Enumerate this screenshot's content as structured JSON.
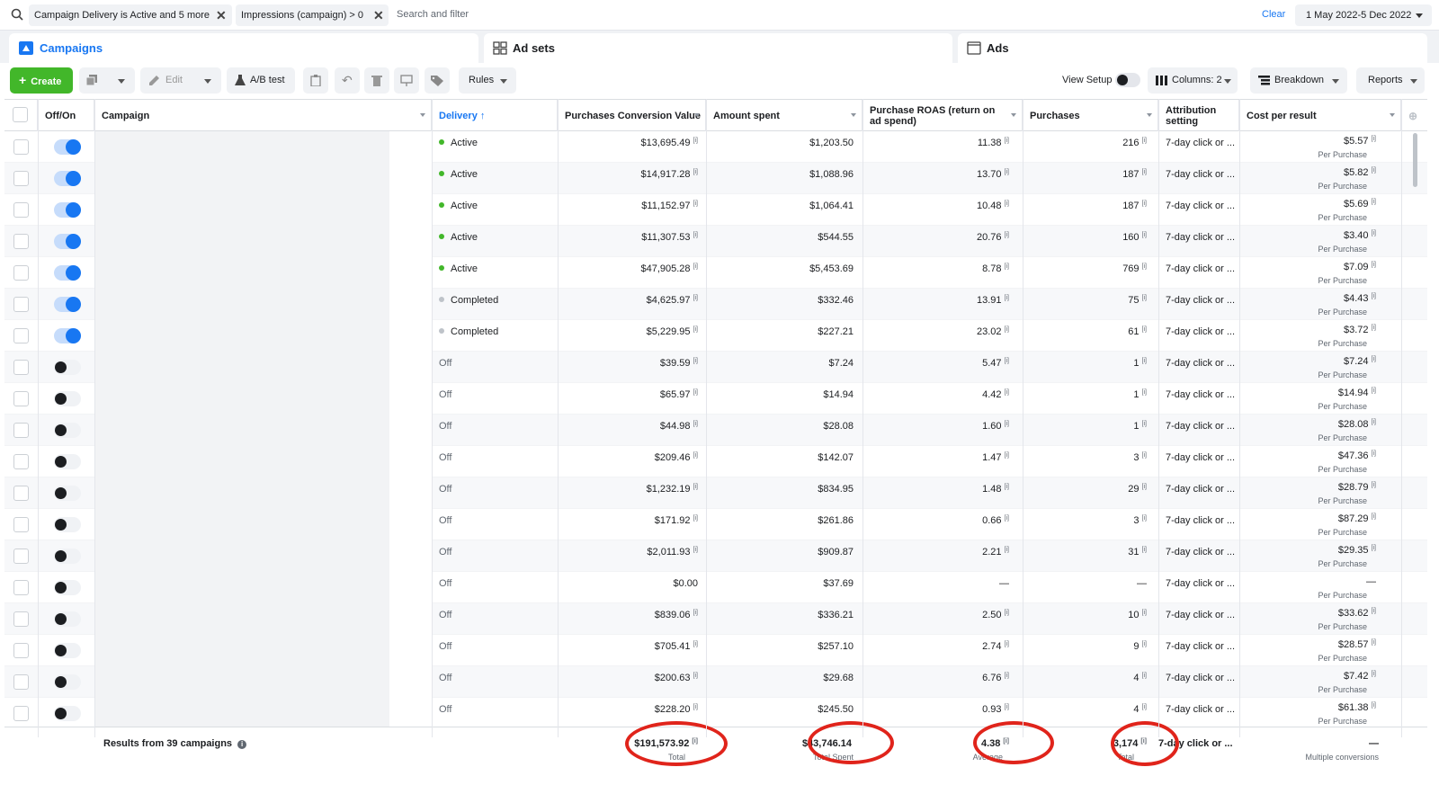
{
  "filters": {
    "chip1": "Campaign Delivery is Active and 5 more",
    "chip2": "Impressions (campaign) > 0",
    "search_placeholder": "Search and filter",
    "clear": "Clear",
    "date_range": "1 May 2022-5 Dec 2022"
  },
  "tabs": [
    {
      "label": "Campaigns",
      "icon": "campaign-icon"
    },
    {
      "label": "Ad sets",
      "icon": "grid-icon"
    },
    {
      "label": "Ads",
      "icon": "ad-icon"
    }
  ],
  "toolbar": {
    "create": "Create",
    "edit": "Edit",
    "ab_test": "A/B test",
    "rules": "Rules",
    "view_setup": "View Setup",
    "columns": "Columns: 2",
    "breakdown": "Breakdown",
    "reports": "Reports"
  },
  "columns": {
    "offon": "Off/On",
    "campaign": "Campaign",
    "delivery": "Delivery ↑",
    "pcv": "Purchases Conversion Value",
    "spent": "Amount spent",
    "roas": "Purchase ROAS (return on ad spend)",
    "purchases": "Purchases",
    "attribution": "Attribution setting",
    "cpr": "Cost per result"
  },
  "rows": [
    {
      "on": true,
      "delivery": "Active",
      "status": "active",
      "pcv": "$13,695.49",
      "spent": "$1,203.50",
      "roas": "11.38",
      "purchases": "216",
      "attr": "7-day click or ...",
      "cpr": "$5.57",
      "cpr_sub": "Per Purchase"
    },
    {
      "on": true,
      "delivery": "Active",
      "status": "active",
      "pcv": "$14,917.28",
      "spent": "$1,088.96",
      "roas": "13.70",
      "purchases": "187",
      "attr": "7-day click or ...",
      "cpr": "$5.82",
      "cpr_sub": "Per Purchase"
    },
    {
      "on": true,
      "delivery": "Active",
      "status": "active",
      "pcv": "$11,152.97",
      "spent": "$1,064.41",
      "roas": "10.48",
      "purchases": "187",
      "attr": "7-day click or ...",
      "cpr": "$5.69",
      "cpr_sub": "Per Purchase"
    },
    {
      "on": true,
      "delivery": "Active",
      "status": "active",
      "pcv": "$11,307.53",
      "spent": "$544.55",
      "roas": "20.76",
      "purchases": "160",
      "attr": "7-day click or ...",
      "cpr": "$3.40",
      "cpr_sub": "Per Purchase"
    },
    {
      "on": true,
      "delivery": "Active",
      "status": "active",
      "pcv": "$47,905.28",
      "spent": "$5,453.69",
      "roas": "8.78",
      "purchases": "769",
      "attr": "7-day click or ...",
      "cpr": "$7.09",
      "cpr_sub": "Per Purchase"
    },
    {
      "on": true,
      "delivery": "Completed",
      "status": "completed",
      "pcv": "$4,625.97",
      "spent": "$332.46",
      "roas": "13.91",
      "purchases": "75",
      "attr": "7-day click or ...",
      "cpr": "$4.43",
      "cpr_sub": "Per Purchase"
    },
    {
      "on": true,
      "delivery": "Completed",
      "status": "completed",
      "pcv": "$5,229.95",
      "spent": "$227.21",
      "roas": "23.02",
      "purchases": "61",
      "attr": "7-day click or ...",
      "cpr": "$3.72",
      "cpr_sub": "Per Purchase"
    },
    {
      "on": false,
      "delivery": "Off",
      "status": "off",
      "pcv": "$39.59",
      "spent": "$7.24",
      "roas": "5.47",
      "purchases": "1",
      "attr": "7-day click or ...",
      "cpr": "$7.24",
      "cpr_sub": "Per Purchase"
    },
    {
      "on": false,
      "delivery": "Off",
      "status": "off",
      "pcv": "$65.97",
      "spent": "$14.94",
      "roas": "4.42",
      "purchases": "1",
      "attr": "7-day click or ...",
      "cpr": "$14.94",
      "cpr_sub": "Per Purchase"
    },
    {
      "on": false,
      "delivery": "Off",
      "status": "off",
      "pcv": "$44.98",
      "spent": "$28.08",
      "roas": "1.60",
      "purchases": "1",
      "attr": "7-day click or ...",
      "cpr": "$28.08",
      "cpr_sub": "Per Purchase"
    },
    {
      "on": false,
      "delivery": "Off",
      "status": "off",
      "pcv": "$209.46",
      "spent": "$142.07",
      "roas": "1.47",
      "purchases": "3",
      "attr": "7-day click or ...",
      "cpr": "$47.36",
      "cpr_sub": "Per Purchase"
    },
    {
      "on": false,
      "delivery": "Off",
      "status": "off",
      "pcv": "$1,232.19",
      "spent": "$834.95",
      "roas": "1.48",
      "purchases": "29",
      "attr": "7-day click or ...",
      "cpr": "$28.79",
      "cpr_sub": "Per Purchase"
    },
    {
      "on": false,
      "delivery": "Off",
      "status": "off",
      "pcv": "$171.92",
      "spent": "$261.86",
      "roas": "0.66",
      "purchases": "3",
      "attr": "7-day click or ...",
      "cpr": "$87.29",
      "cpr_sub": "Per Purchase"
    },
    {
      "on": false,
      "delivery": "Off",
      "status": "off",
      "pcv": "$2,011.93",
      "spent": "$909.87",
      "roas": "2.21",
      "purchases": "31",
      "attr": "7-day click or ...",
      "cpr": "$29.35",
      "cpr_sub": "Per Purchase"
    },
    {
      "on": false,
      "delivery": "Off",
      "status": "off",
      "pcv": "$0.00",
      "spent": "$37.69",
      "roas": "—",
      "purchases": "—",
      "attr": "7-day click or ...",
      "cpr": "—",
      "cpr_sub": "Per Purchase",
      "noinfo": true
    },
    {
      "on": false,
      "delivery": "Off",
      "status": "off",
      "pcv": "$839.06",
      "spent": "$336.21",
      "roas": "2.50",
      "purchases": "10",
      "attr": "7-day click or ...",
      "cpr": "$33.62",
      "cpr_sub": "Per Purchase"
    },
    {
      "on": false,
      "delivery": "Off",
      "status": "off",
      "pcv": "$705.41",
      "spent": "$257.10",
      "roas": "2.74",
      "purchases": "9",
      "attr": "7-day click or ...",
      "cpr": "$28.57",
      "cpr_sub": "Per Purchase"
    },
    {
      "on": false,
      "delivery": "Off",
      "status": "off",
      "pcv": "$200.63",
      "spent": "$29.68",
      "roas": "6.76",
      "purchases": "4",
      "attr": "7-day click or ...",
      "cpr": "$7.42",
      "cpr_sub": "Per Purchase"
    },
    {
      "on": false,
      "delivery": "Off",
      "status": "off",
      "pcv": "$228.20",
      "spent": "$245.50",
      "roas": "0.93",
      "purchases": "4",
      "attr": "7-day click or ...",
      "cpr": "$61.38",
      "cpr_sub": "Per Purchase"
    }
  ],
  "footer": {
    "results": "Results from 39 campaigns",
    "pcv_total": "$191,573.92",
    "pcv_label": "Total",
    "spent_total": "$43,746.14",
    "spent_label": "Total Spent",
    "roas_avg": "4.38",
    "roas_label": "Average",
    "purchases_total": "3,174",
    "purchases_label": "Total",
    "attr": "7-day click or ...",
    "cpr": "—",
    "cpr_label": "Multiple conversions"
  },
  "info_icon_glyph": "[i]",
  "colors": {
    "accent": "#1877f2",
    "active_dot": "#42b72a",
    "completed_dot": "#bec3c9",
    "highlight_ring": "#e0241b",
    "create_button": "#42b72a"
  }
}
